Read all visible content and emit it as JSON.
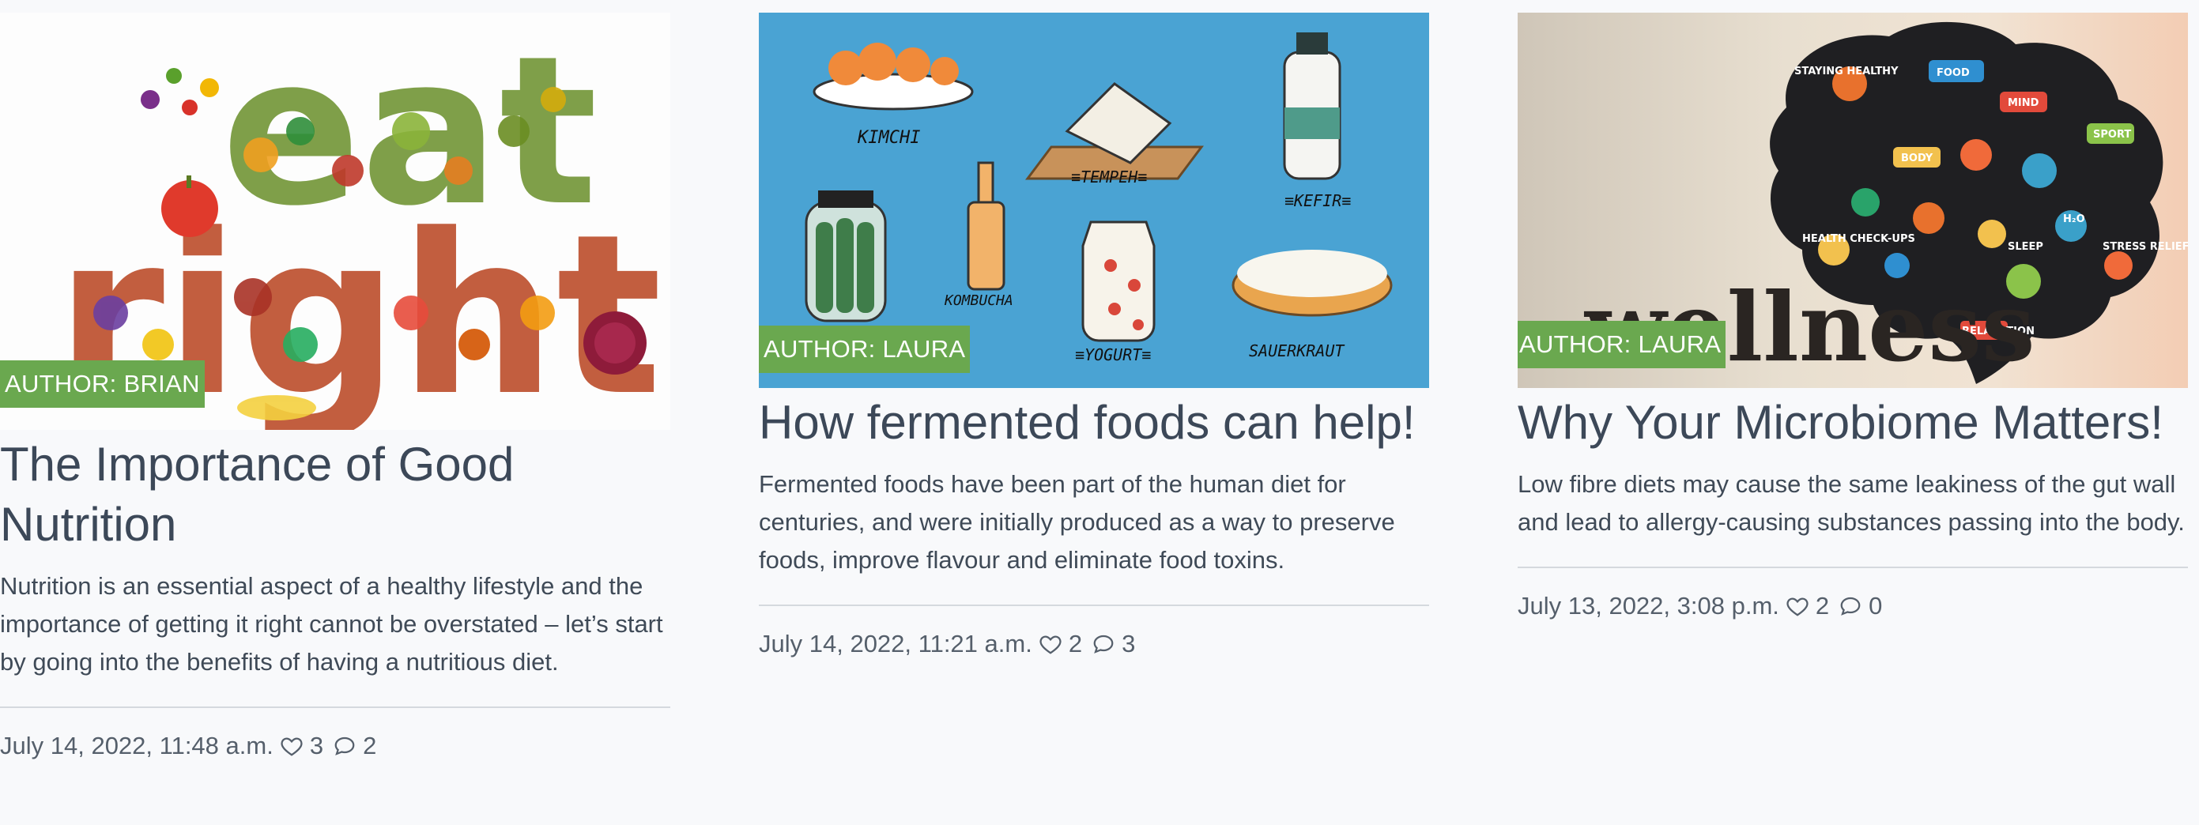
{
  "posts": [
    {
      "author": "AUTHOR: BRIAN",
      "title": "The Importance of Good Nutrition",
      "excerpt": "Nutrition is an essential aspect of a healthy lifestyle and the importance of getting it right cannot be overstated – let’s start by going into the benefits of having a nutritious diet.",
      "date": "July 14, 2022, 11:48 a.m.",
      "likes": "3",
      "comments": "2",
      "image_text": [
        "eat",
        "right."
      ]
    },
    {
      "author": "AUTHOR: LAURA",
      "title": "How fermented foods can help!",
      "excerpt": "Fermented foods have been part of the human diet for centuries, and were initially produced as a way to preserve foods, improve flavour and eliminate food toxins.",
      "date": "July 14, 2022, 11:21 a.m.",
      "likes": "2",
      "comments": "3",
      "image_labels": [
        "KIMCHI",
        "≡TEMPEH≡",
        "≡KEFIR≡",
        "KOMBUCHA",
        "≡YOGURT≡",
        "SAUERKRAUT"
      ]
    },
    {
      "author": "AUTHOR: LAURA",
      "title": "Why Your Microbiome Matters!",
      "excerpt": "Low fibre diets may cause the same leakiness of the gut wall and lead to allergy-causing substances passing into the body.",
      "date": "July 13, 2022, 3:08 p.m.",
      "likes": "2",
      "comments": "0",
      "image_text": "wellness",
      "image_labels": [
        "STAYING HEALTHY",
        "FOOD",
        "MIND",
        "SPORT",
        "BODY",
        "H₂O",
        "HEALTH CHECK-UPS",
        "SLEEP",
        "STRESS RELIEF",
        "RELAXATION"
      ]
    }
  ],
  "icons": {
    "like": "heart-icon",
    "comment": "speech-bubble-icon"
  },
  "colors": {
    "badge": "#6aa84f",
    "title": "#3c4858",
    "text": "#3f4a57",
    "background": "#f8f9fb",
    "divider": "#d5d9de"
  }
}
